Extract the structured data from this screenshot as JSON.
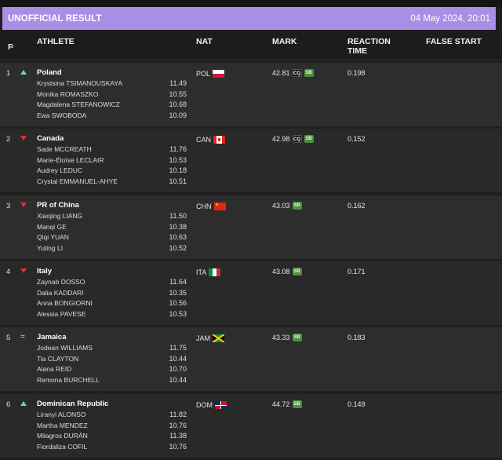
{
  "banner": {
    "title": "UNOFFICIAL RESULT",
    "date": "04 May 2024, 20:01",
    "color": "#a98ee6"
  },
  "header": {
    "pos": "P",
    "sort_icon": "sort-icon",
    "athlete": "ATHLETE",
    "nat": "NAT",
    "mark": "MARK",
    "reaction_1": "REACTION",
    "reaction_2": "TIME",
    "false_start": "FALSE START"
  },
  "rows": [
    {
      "pos": "1",
      "trend": "up",
      "team": "Poland",
      "nat": "POL",
      "mark": "42.81",
      "badges": [
        "CQ",
        "SB"
      ],
      "reaction": "0.198",
      "athletes": [
        {
          "name": "Krystsina TSIMANOUSKAYA",
          "split": "11.49"
        },
        {
          "name": "Monika ROMASZKO",
          "split": "10.55"
        },
        {
          "name": "Magdalena STEFANOWICZ",
          "split": "10.68"
        },
        {
          "name": "Ewa SWOBODA",
          "split": "10.09"
        }
      ]
    },
    {
      "pos": "2",
      "trend": "down",
      "team": "Canada",
      "nat": "CAN",
      "mark": "42.98",
      "badges": [
        "CQ",
        "SB"
      ],
      "reaction": "0.152",
      "athletes": [
        {
          "name": "Sade MCCREATH",
          "split": "11.76"
        },
        {
          "name": "Marie-Éloïse LECLAIR",
          "split": "10.53"
        },
        {
          "name": "Audrey LEDUC",
          "split": "10.18"
        },
        {
          "name": "Crystal EMMANUEL-AHYE",
          "split": "10.51"
        }
      ]
    },
    {
      "pos": "3",
      "trend": "down",
      "team": "PR of China",
      "nat": "CHN",
      "mark": "43.03",
      "badges": [
        "SB"
      ],
      "reaction": "0.162",
      "athletes": [
        {
          "name": "Xiaojing LIANG",
          "split": "11.50"
        },
        {
          "name": "Manqi GE",
          "split": "10.38"
        },
        {
          "name": "Qiqi YUAN",
          "split": "10.63"
        },
        {
          "name": "Yuting LI",
          "split": "10.52"
        }
      ]
    },
    {
      "pos": "4",
      "trend": "down",
      "team": "Italy",
      "nat": "ITA",
      "mark": "43.08",
      "badges": [
        "SB"
      ],
      "reaction": "0.171",
      "athletes": [
        {
          "name": "Zaynab DOSSO",
          "split": "11.64"
        },
        {
          "name": "Dalia KADDARI",
          "split": "10.35"
        },
        {
          "name": "Anna BONGIORNI",
          "split": "10.56"
        },
        {
          "name": "Alessia PAVESE",
          "split": "10.53"
        }
      ]
    },
    {
      "pos": "5",
      "trend": "same",
      "trend_glyph": "=",
      "team": "Jamaica",
      "nat": "JAM",
      "mark": "43.33",
      "badges": [
        "SB"
      ],
      "reaction": "0.183",
      "athletes": [
        {
          "name": "Jodean WILLIAMS",
          "split": "11.75"
        },
        {
          "name": "Tia CLAYTON",
          "split": "10.44"
        },
        {
          "name": "Alana REID",
          "split": "10.70"
        },
        {
          "name": "Remona BURCHELL",
          "split": "10.44"
        }
      ]
    },
    {
      "pos": "6",
      "trend": "up",
      "team": "Dominican Republic",
      "nat": "DOM",
      "mark": "44.72",
      "badges": [
        "SB"
      ],
      "reaction": "0.149",
      "athletes": [
        {
          "name": "Liranyi ALONSO",
          "split": "11.82"
        },
        {
          "name": "Martha MENDEZ",
          "split": "10.76"
        },
        {
          "name": "Milagros DURÁN",
          "split": "11.38"
        },
        {
          "name": "Fiordaliza COFIL",
          "split": "10.76"
        }
      ]
    }
  ]
}
